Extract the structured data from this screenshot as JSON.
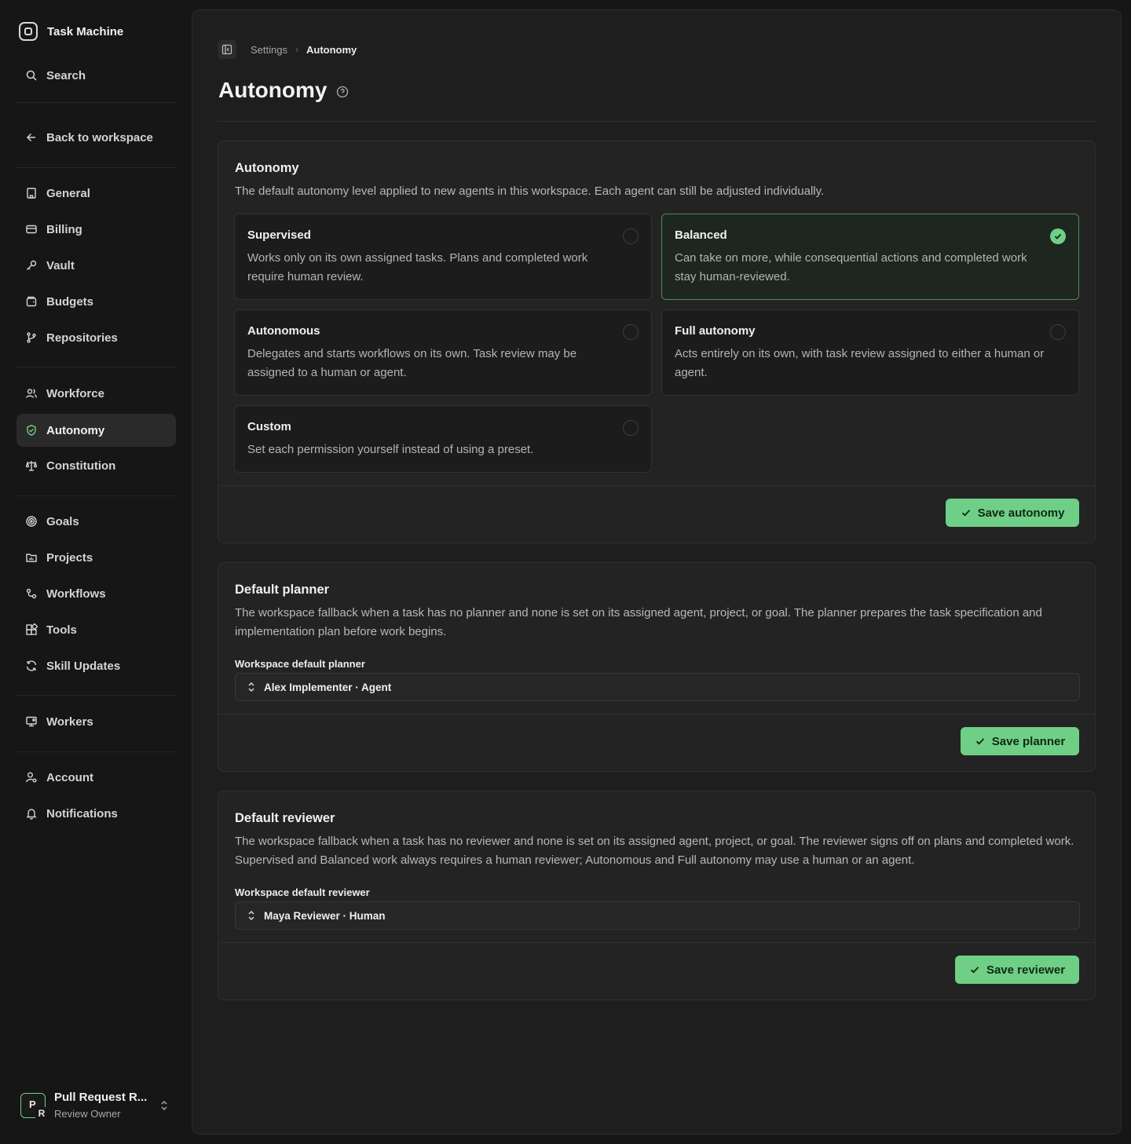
{
  "app": {
    "name": "Task Machine"
  },
  "sidebar": {
    "search_label": "Search",
    "back_label": "Back to workspace",
    "items": [
      {
        "label": "General",
        "icon": "building-icon"
      },
      {
        "label": "Billing",
        "icon": "credit-card-icon"
      },
      {
        "label": "Vault",
        "icon": "key-icon"
      },
      {
        "label": "Budgets",
        "icon": "wallet-icon"
      },
      {
        "label": "Repositories",
        "icon": "git-branch-icon"
      },
      {
        "label": "Workforce",
        "icon": "users-icon"
      },
      {
        "label": "Autonomy",
        "icon": "shield-check-icon",
        "active": true
      },
      {
        "label": "Constitution",
        "icon": "scale-icon"
      },
      {
        "label": "Goals",
        "icon": "target-icon"
      },
      {
        "label": "Projects",
        "icon": "folder-icon"
      },
      {
        "label": "Workflows",
        "icon": "workflow-icon"
      },
      {
        "label": "Tools",
        "icon": "blocks-icon"
      },
      {
        "label": "Skill Updates",
        "icon": "refresh-icon"
      },
      {
        "label": "Workers",
        "icon": "monitor-icon"
      },
      {
        "label": "Account",
        "icon": "user-cog-icon"
      },
      {
        "label": "Notifications",
        "icon": "bell-icon"
      }
    ],
    "user": {
      "initial": "P",
      "badge": "R",
      "name": "Pull Request R...",
      "role": "Review Owner"
    }
  },
  "breadcrumb": {
    "parent": "Settings",
    "current": "Autonomy"
  },
  "page": {
    "title": "Autonomy"
  },
  "autonomy_card": {
    "title": "Autonomy",
    "description": "The default autonomy level applied to new agents in this workspace. Each agent can still be adjusted individually.",
    "options": [
      {
        "title": "Supervised",
        "description": "Works only on its own assigned tasks. Plans and completed work require human review.",
        "selected": false
      },
      {
        "title": "Balanced",
        "description": "Can take on more, while consequential actions and completed work stay human-reviewed.",
        "selected": true
      },
      {
        "title": "Autonomous",
        "description": "Delegates and starts workflows on its own. Task review may be assigned to a human or agent.",
        "selected": false
      },
      {
        "title": "Full autonomy",
        "description": "Acts entirely on its own, with task review assigned to either a human or agent.",
        "selected": false
      },
      {
        "title": "Custom",
        "description": "Set each permission yourself instead of using a preset.",
        "selected": false
      }
    ],
    "save_label": "Save autonomy"
  },
  "planner_card": {
    "title": "Default planner",
    "description": "The workspace fallback when a task has no planner and none is set on its assigned agent, project, or goal. The planner prepares the task specification and implementation plan before work begins.",
    "field_label": "Workspace default planner",
    "value": "Alex Implementer · Agent",
    "save_label": "Save planner"
  },
  "reviewer_card": {
    "title": "Default reviewer",
    "description": "The workspace fallback when a task has no reviewer and none is set on its assigned agent, project, or goal. The reviewer signs off on plans and completed work. Supervised and Balanced work always requires a human reviewer; Autonomous and Full autonomy may use a human or an agent.",
    "field_label": "Workspace default reviewer",
    "value": "Maya Reviewer · Human",
    "save_label": "Save reviewer"
  },
  "colors": {
    "accent": "#6fcf86",
    "background": "#161616",
    "panel": "#1e1e1e",
    "card": "#232323"
  }
}
